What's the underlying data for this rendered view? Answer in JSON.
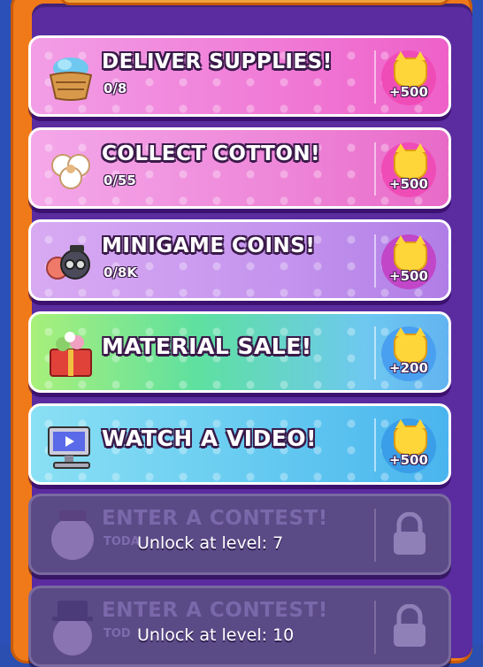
{
  "tasks": [
    {
      "title": "DELIVER SUPPLIES!",
      "progress": "0/8",
      "reward": "+500",
      "icon": "basket-icon"
    },
    {
      "title": "COLLECT COTTON!",
      "progress": "0/55",
      "reward": "+500",
      "icon": "cotton-icon"
    },
    {
      "title": "MINIGAME COINS!",
      "progress": "0/8K",
      "reward": "+500",
      "icon": "coins-icon"
    },
    {
      "title": "MATERIAL SALE!",
      "progress": "",
      "reward": "+200",
      "icon": "gift-box-icon"
    },
    {
      "title": "WATCH A VIDEO!",
      "progress": "",
      "reward": "+500",
      "icon": "computer-icon"
    }
  ],
  "locked": [
    {
      "title": "ENTER A CONTEST!",
      "sub": "TODA",
      "unlock": "Unlock at level: 7",
      "icon": "cat-avatar-icon"
    },
    {
      "title": "ENTER A CONTEST!",
      "sub": "TOD",
      "unlock": "Unlock at level: 10",
      "icon": "tophat-cat-icon"
    }
  ],
  "colors": {
    "frame": "#f07a1a",
    "panel": "#5a2ca0",
    "coin": "#ffd63a"
  }
}
